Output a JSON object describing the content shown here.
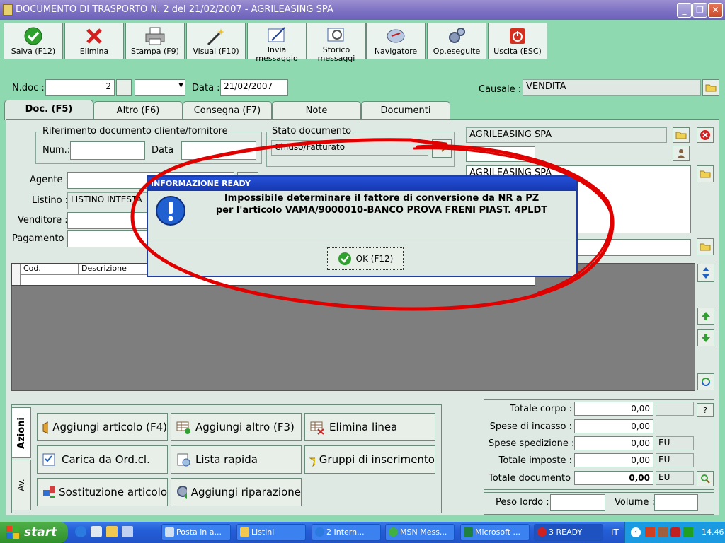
{
  "window": {
    "title": "DOCUMENTO DI TRASPORTO N. 2  del 21/02/2007 - AGRILEASING SPA"
  },
  "toolbar": {
    "items": [
      {
        "label": "Salva (F12)"
      },
      {
        "label": "Elimina"
      },
      {
        "label": "Stampa (F9)"
      },
      {
        "label": "Visual (F10)"
      },
      {
        "label": "Invia messaggio"
      },
      {
        "label": "Storico messaggi"
      },
      {
        "label": "Navigatore"
      },
      {
        "label": "Op.eseguite"
      },
      {
        "label": "Uscita (ESC)"
      }
    ]
  },
  "header": {
    "ndoc_label": "N.doc :",
    "ndoc_value": "2",
    "data_label": "Data :",
    "data_value": "21/02/2007",
    "causale_label": "Causale :",
    "causale_value": "VENDITA"
  },
  "tabs": [
    {
      "label": "Doc. (F5)"
    },
    {
      "label": "Altro (F6)"
    },
    {
      "label": "Consegna (F7)"
    },
    {
      "label": "Note"
    },
    {
      "label": "Documenti"
    }
  ],
  "rif": {
    "legend": "Riferimento documento cliente/fornitore",
    "num_label": "Num.:",
    "data_label": "Data"
  },
  "stato": {
    "legend": "Stato documento",
    "value": "Chiuso/Fatturato"
  },
  "form": {
    "agente_label": "Agente :",
    "listino_label": "Listino :",
    "listino_value": "LISTINO INTESTA",
    "venditore_label": "Venditore :",
    "pagamento_label": "Pagamento :"
  },
  "customer": {
    "name": "AGRILEASING SPA",
    "name2": "AGRILEASING SPA"
  },
  "grid": {
    "columns": [
      "Cod.",
      "Descrizione"
    ]
  },
  "actions": {
    "vtab_azioni": "Azioni",
    "vtab_av": "Av.",
    "buttons": [
      {
        "label": "Aggiungi articolo (F4)"
      },
      {
        "label": "Aggiungi altro (F3)"
      },
      {
        "label": "Elimina linea"
      },
      {
        "label": "Carica da Ord.cl."
      },
      {
        "label": "Lista rapida"
      },
      {
        "label": "Gruppi di inserimento"
      },
      {
        "label": "Sostituzione articolo"
      },
      {
        "label": "Aggiungi riparazione"
      }
    ]
  },
  "totals": {
    "rows": [
      {
        "label": "Totale corpo :",
        "value": "0,00",
        "unit": ""
      },
      {
        "label": "Spese di incasso :",
        "value": "0,00",
        "unit": ""
      },
      {
        "label": "Spese spedizione :",
        "value": "0,00",
        "unit": "EU"
      },
      {
        "label": "Totale imposte :",
        "value": "0,00",
        "unit": "EU"
      },
      {
        "label": "Totale documento :",
        "value": "0,00",
        "unit": "EU"
      }
    ],
    "help": "?",
    "peso_label": "Peso lordo :",
    "volume_label": "Volume :"
  },
  "dialog": {
    "title": "INFORMAZIONE READY",
    "line1": "Impossibile determinare il fattore di conversione da NR a PZ",
    "line2": "per l'articolo VAMA/9000010-BANCO PROVA FRENI PIAST. 4PLDT",
    "ok_label": "OK (F12)"
  },
  "taskbar": {
    "start": "start",
    "items": [
      {
        "label": "Posta in a..."
      },
      {
        "label": "Listini"
      },
      {
        "label": "2 Intern..."
      },
      {
        "label": "MSN Mess..."
      },
      {
        "label": "Microsoft ..."
      },
      {
        "label": "3 READY"
      }
    ],
    "lang": "IT",
    "clock": "14.46"
  },
  "colors": {
    "accent": "#1e3fa0",
    "background": "#8fd9b0",
    "annotation": "#e00000"
  }
}
